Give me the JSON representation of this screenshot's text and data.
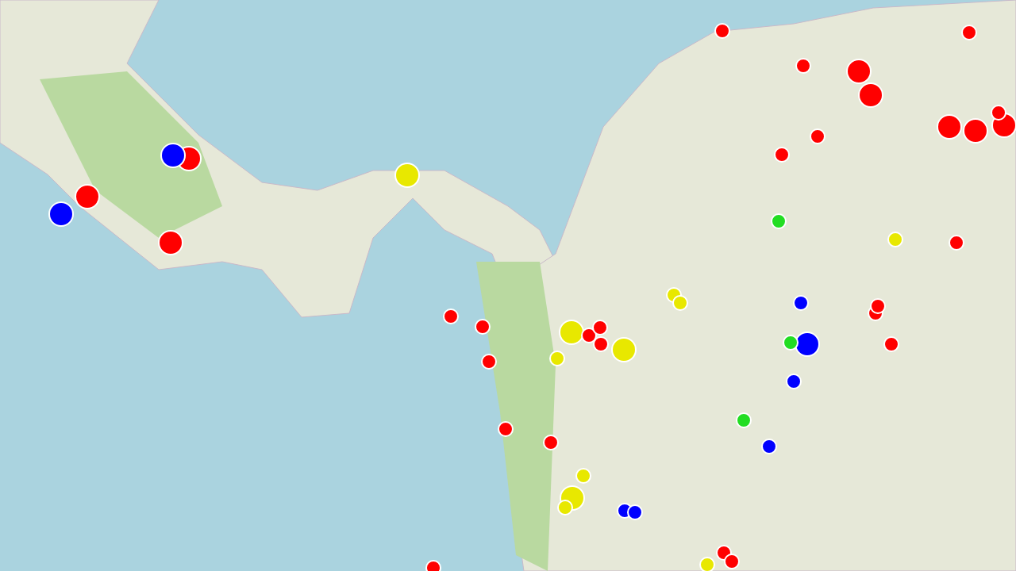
{
  "map": {
    "markers": [
      {
        "color": "#ff0000",
        "kind": "large"
      },
      {
        "color": "#ff0000",
        "kind": "large"
      },
      {
        "color": "#ff0000",
        "kind": "large"
      },
      {
        "color": "#ff0000",
        "kind": "large"
      },
      {
        "color": "#ff0000",
        "kind": "large"
      },
      {
        "color": "#ff0000",
        "kind": "large"
      },
      {
        "color": "#ff0000",
        "kind": "large"
      },
      {
        "color": "#ff0000",
        "kind": "large"
      },
      {
        "color": "#0000ff",
        "kind": "large"
      },
      {
        "color": "#0000ff",
        "kind": "large"
      },
      {
        "color": "#0000ff",
        "kind": "large"
      },
      {
        "color": "#e8e800",
        "kind": "large"
      },
      {
        "color": "#e8e800",
        "kind": "large"
      },
      {
        "color": "#e8e800",
        "kind": "large"
      },
      {
        "color": "#e8e800",
        "kind": "large"
      },
      {
        "color": "#ff0000",
        "kind": "small"
      },
      {
        "color": "#ff0000",
        "kind": "small"
      },
      {
        "color": "#ff0000",
        "kind": "small"
      },
      {
        "color": "#ff0000",
        "kind": "small"
      },
      {
        "color": "#ff0000",
        "kind": "small"
      },
      {
        "color": "#ff0000",
        "kind": "small"
      },
      {
        "color": "#ff0000",
        "kind": "small"
      },
      {
        "color": "#ff0000",
        "kind": "small"
      },
      {
        "color": "#ff0000",
        "kind": "small"
      },
      {
        "color": "#ff0000",
        "kind": "small"
      },
      {
        "color": "#ff0000",
        "kind": "small"
      },
      {
        "color": "#ff0000",
        "kind": "small"
      },
      {
        "color": "#ff0000",
        "kind": "small"
      },
      {
        "color": "#ff0000",
        "kind": "small"
      },
      {
        "color": "#ff0000",
        "kind": "small"
      },
      {
        "color": "#ff0000",
        "kind": "small"
      },
      {
        "color": "#ff0000",
        "kind": "small"
      },
      {
        "color": "#ff0000",
        "kind": "small"
      },
      {
        "color": "#ff0000",
        "kind": "small"
      },
      {
        "color": "#ff0000",
        "kind": "small"
      },
      {
        "color": "#ff0000",
        "kind": "small"
      },
      {
        "color": "#e8e800",
        "kind": "small"
      },
      {
        "color": "#e8e800",
        "kind": "small"
      },
      {
        "color": "#e8e800",
        "kind": "small"
      },
      {
        "color": "#e8e800",
        "kind": "small"
      },
      {
        "color": "#e8e800",
        "kind": "small"
      },
      {
        "color": "#e8e800",
        "kind": "small"
      },
      {
        "color": "#e8e800",
        "kind": "small"
      },
      {
        "color": "#22dd22",
        "kind": "small"
      },
      {
        "color": "#22dd22",
        "kind": "small"
      },
      {
        "color": "#22dd22",
        "kind": "small"
      },
      {
        "color": "#0000ff",
        "kind": "small"
      },
      {
        "color": "#0000ff",
        "kind": "small"
      },
      {
        "color": "#0000ff",
        "kind": "small"
      },
      {
        "color": "#0000ff",
        "kind": "small"
      },
      {
        "color": "#0000ff",
        "kind": "small"
      }
    ]
  }
}
